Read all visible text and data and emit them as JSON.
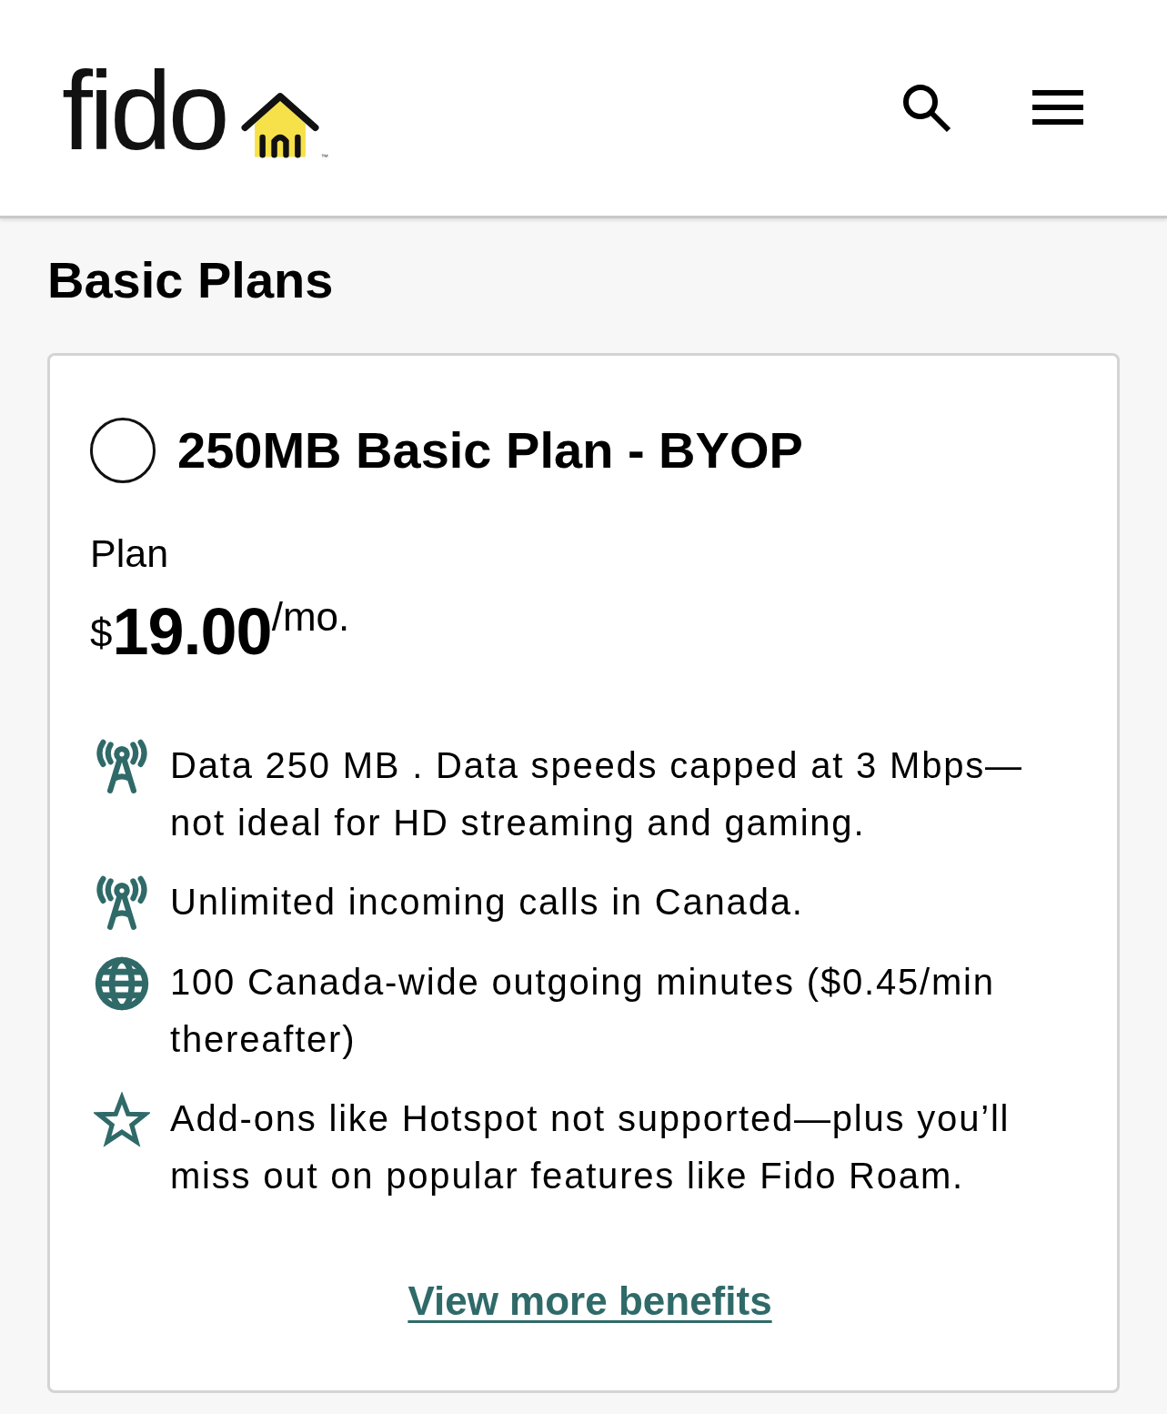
{
  "header": {
    "logo": {
      "text": "fido",
      "trademark": "™"
    }
  },
  "page": {
    "title": "Basic Plans"
  },
  "plan": {
    "name": "250MB Basic Plan - BYOP",
    "selected": false,
    "label": "Plan",
    "price": {
      "currency": "$",
      "amount": "19.00",
      "period": "/mo."
    },
    "features": [
      {
        "kind": "tower",
        "text": "Data 250 MB . Data speeds capped at 3 Mbps—not ideal for HD streaming and gaming."
      },
      {
        "kind": "tower",
        "text": "Unlimited incoming calls in Canada."
      },
      {
        "kind": "globe",
        "text": "100 Canada-wide outgoing minutes ($0.45/min thereafter)"
      },
      {
        "kind": "star",
        "text": "Add-ons like Hotspot not supported—plus you’ll miss out on popular features like Fido Roam."
      }
    ],
    "link": "View more benefits"
  }
}
